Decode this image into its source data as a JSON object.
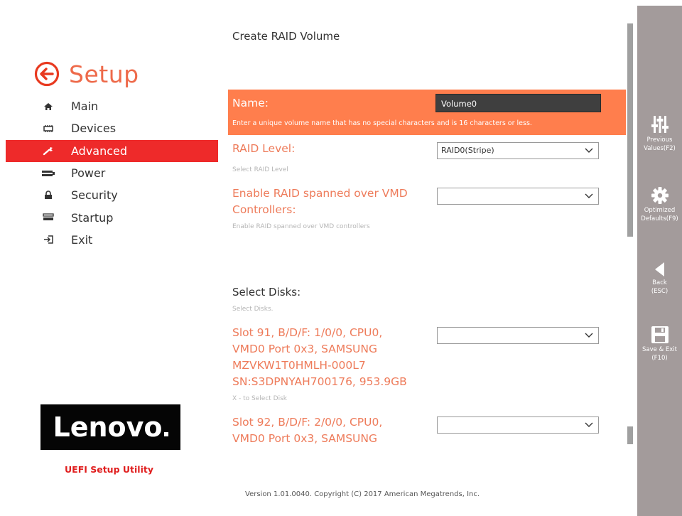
{
  "sidebar": {
    "title": "Setup",
    "items": [
      {
        "label": "Main",
        "icon": "home-icon"
      },
      {
        "label": "Devices",
        "icon": "devices-icon"
      },
      {
        "label": "Advanced",
        "icon": "wrench-icon"
      },
      {
        "label": "Power",
        "icon": "power-icon"
      },
      {
        "label": "Security",
        "icon": "lock-icon"
      },
      {
        "label": "Startup",
        "icon": "startup-icon"
      },
      {
        "label": "Exit",
        "icon": "exit-icon"
      }
    ],
    "active_index": 2,
    "logo_text": "Lenovo",
    "utility_label": "UEFI Setup Utility"
  },
  "main": {
    "title": "Create RAID Volume",
    "name": {
      "label": "Name:",
      "value": "Volume0",
      "help": "Enter a unique volume name that has no special characters and is 16 characters or less."
    },
    "raid_level": {
      "label": "RAID Level:",
      "value": "RAID0(Stripe)",
      "help": "Select RAID Level"
    },
    "vmd": {
      "label_line1": "Enable RAID spanned over VMD",
      "label_line2": "Controllers:",
      "value": "",
      "help": "Enable RAID spanned over VMD controllers"
    },
    "select_disks": {
      "label": "Select Disks:",
      "help": "Select Disks."
    },
    "disk1": {
      "line1": "Slot 91, B/D/F: 1/0/0, CPU0,",
      "line2": "VMD0 Port 0x3, SAMSUNG",
      "line3": "MZVKW1T0HMLH-000L7",
      "line4": "SN:S3DPNYAH700176, 953.9GB",
      "value": "",
      "help": "X - to Select Disk"
    },
    "disk2": {
      "line1": "Slot 92, B/D/F: 2/0/0, CPU0,",
      "line2": "VMD0 Port 0x3, SAMSUNG",
      "value": ""
    },
    "version": "Version 1.01.0040. Copyright (C) 2017 American Megatrends, Inc."
  },
  "toolbar": {
    "previous_line1": "Previous",
    "previous_line2": "Values(F2)",
    "optimized_line1": "Optimized",
    "optimized_line2": "Defaults(F9)",
    "back_line1": "Back",
    "back_line2": "(ESC)",
    "save_line1": "Save & Exit",
    "save_line2": "(F10)"
  },
  "colors": {
    "accent": "#ee6a4a",
    "active_nav": "#ee2a2a",
    "highlight_row": "#ff7e4d",
    "toolbar_bg": "#a39b9b"
  }
}
